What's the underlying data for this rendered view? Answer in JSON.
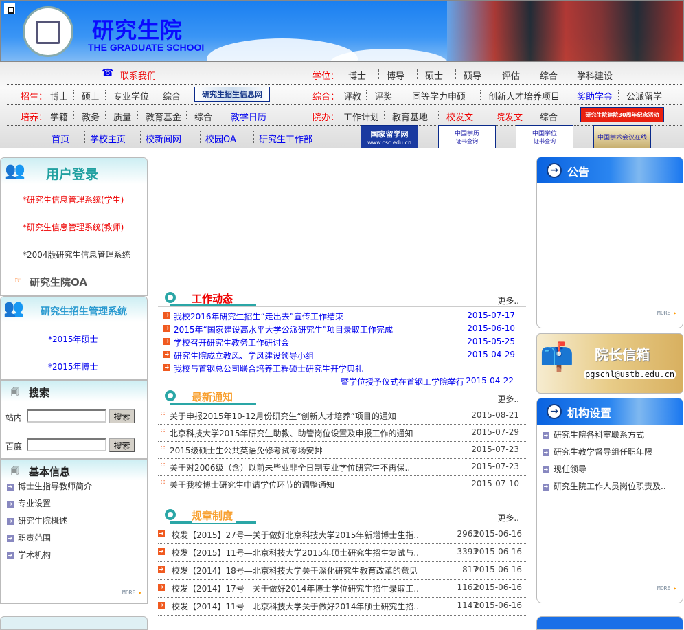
{
  "banner": {
    "title_cn": "研究生院",
    "title_en": "THE GRADUATE SCHOOI"
  },
  "nav": {
    "contact": "联系我们",
    "degree": {
      "label": "学位：",
      "items": [
        "博士",
        "博导",
        "硕士",
        "硕导",
        "评估",
        "综合",
        "学科建设"
      ]
    },
    "admission": {
      "label": "招生：",
      "items": [
        "博士",
        "硕士",
        "专业学位",
        "综合"
      ],
      "banner_button": "研究生招生信息网"
    },
    "general": {
      "label": "综合：",
      "items": [
        "评教",
        "评奖",
        "同等学力申硕",
        "创新人才培养项目",
        "奖助学金",
        "公派留学"
      ]
    },
    "training": {
      "label": "培养：",
      "items": [
        "学籍",
        "教务",
        "质量",
        "教育基金",
        "综合",
        "教学日历"
      ]
    },
    "office": {
      "label": "院办：",
      "items": [
        "工作计划",
        "教育基地",
        "校发文",
        "院发文",
        "综合"
      ],
      "anniversary_button": "研究生院建院30周年纪念活动"
    },
    "links": [
      "首页",
      "学校主页",
      "校新闻网",
      "校园OA",
      "研究生工作部"
    ],
    "logos": [
      {
        "line1": "国家留学网",
        "line2": "www.csc.edu.cn"
      },
      {
        "line1": "中国学历",
        "line2": "证书查询"
      },
      {
        "line1": "中国学位",
        "line2": "证书查询"
      },
      {
        "line1": "中国学术会议在线",
        "line2": ""
      }
    ]
  },
  "left": {
    "login": {
      "title": "用户登录",
      "items": [
        "*研究生信息管理系统(学生)",
        "*研究生信息管理系统(教师)",
        "*2004版研究生信息管理系统"
      ],
      "oa": "研究生院OA"
    },
    "recruit": {
      "title": "研究生招生管理系统",
      "items": [
        "*2015年硕士",
        "*2015年博士"
      ]
    },
    "search": {
      "title": "搜索",
      "site_label": "站内",
      "baidu_label": "百度",
      "button": "搜索",
      "site_value": "",
      "baidu_value": ""
    },
    "basic": {
      "title": "基本信息",
      "items": [
        "博士生指导教师简介",
        "专业设置",
        "研究生院概述",
        "职责范围",
        "学术机构"
      ],
      "more": "MORE"
    }
  },
  "center": {
    "more": "更多..",
    "work": {
      "title": "工作动态",
      "items": [
        {
          "text": "我校2016年研究生招生“走出去”宣传工作结束",
          "date": "2015-07-17"
        },
        {
          "text": "2015年“国家建设高水平大学公派研究生”项目录取工作完成",
          "date": "2015-06-10"
        },
        {
          "text": "学校召开研究生教务工作研讨会",
          "date": "2015-05-25"
        },
        {
          "text": "研究生院成立教风、学风建设领导小组",
          "date": "2015-04-29"
        },
        {
          "text": "我校与首钢总公司联合培养工程硕士研究生开学典礼",
          "text2": "暨学位授予仪式在首钢工学院举行",
          "date": "2015-04-22"
        }
      ]
    },
    "notice": {
      "title": "最新通知",
      "items": [
        {
          "text": "关于申报2015年10-12月份研究生“创新人才培养”项目的通知",
          "date": "2015-08-21"
        },
        {
          "text": "北京科技大学2015年研究生助教、助管岗位设置及申报工作的通知",
          "date": "2015-07-29"
        },
        {
          "text": "2015级硕士生公共英语免修考试考场安排",
          "date": "2015-07-23"
        },
        {
          "text": "关于对2006级（含）以前未毕业非全日制专业学位研究生不再保..",
          "date": "2015-07-23"
        },
        {
          "text": "关于我校博士研究生申请学位环节的调整通知",
          "date": "2015-07-10"
        }
      ]
    },
    "rules": {
      "title": "规章制度",
      "items": [
        {
          "text": "校发【2015】27号—关于做好北京科技大学2015年新增博士生指..",
          "count": "2963",
          "date": "2015-06-16"
        },
        {
          "text": "校发【2015】11号—北京科技大学2015年硕士研究生招生复试与..",
          "count": "3393",
          "date": "2015-06-16"
        },
        {
          "text": "校发【2014】18号—北京科技大学关于深化研究生教育改革的意见",
          "count": "817",
          "date": "2015-06-16"
        },
        {
          "text": "校发【2014】17号—关于做好2014年博士学位研究生招生录取工..",
          "count": "1162",
          "date": "2015-06-16"
        },
        {
          "text": "校发【2014】11号—北京科技大学关于做好2014年硕士研究生招..",
          "count": "1147",
          "date": "2015-06-16"
        }
      ]
    }
  },
  "right": {
    "announce": {
      "title": "公告",
      "more": "MORE"
    },
    "mailbox": {
      "title": "院长信箱",
      "email": "pgschl@ustb.edu.cn"
    },
    "org": {
      "title": "机构设置",
      "items": [
        "研究生院各科室联系方式",
        "研究生教学督导组任职年限",
        "现任领导",
        "研究生院工作人员岗位职责及.."
      ],
      "more": "MORE"
    }
  }
}
